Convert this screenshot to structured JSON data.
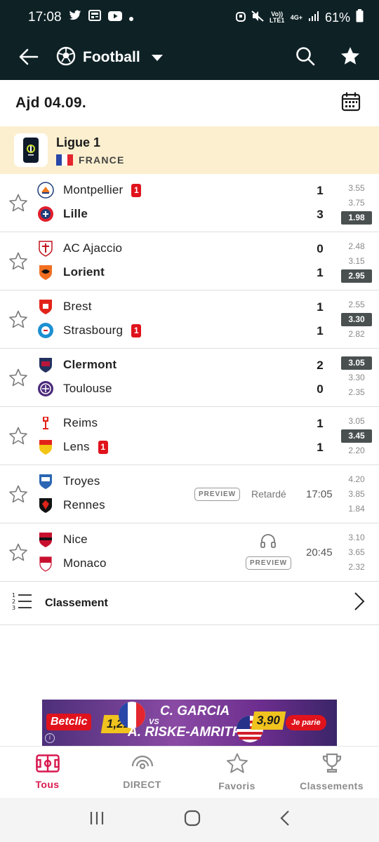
{
  "status_bar": {
    "time": "17:08",
    "network": "Vo)) LTE1",
    "net_type": "4G+",
    "battery": "61%"
  },
  "app_bar": {
    "sport_title": "Football"
  },
  "date_bar": {
    "date": "Ajd 04.09."
  },
  "league": {
    "name": "Ligue 1",
    "country": "FRANCE"
  },
  "matches": [
    {
      "home": "Montpellier",
      "away": "Lille",
      "home_bold": false,
      "away_bold": true,
      "home_red": "1",
      "away_red": "",
      "score_home": "1",
      "score_away": "3",
      "odds": [
        "3.55",
        "3.75",
        "1.98"
      ],
      "highlight": 2
    },
    {
      "home": "AC Ajaccio",
      "away": "Lorient",
      "home_bold": false,
      "away_bold": true,
      "home_red": "",
      "away_red": "",
      "score_home": "0",
      "score_away": "1",
      "odds": [
        "2.48",
        "3.15",
        "2.95"
      ],
      "highlight": 2
    },
    {
      "home": "Brest",
      "away": "Strasbourg",
      "home_bold": false,
      "away_bold": false,
      "home_red": "",
      "away_red": "1",
      "score_home": "1",
      "score_away": "1",
      "odds": [
        "2.55",
        "3.30",
        "2.82"
      ],
      "highlight": 1
    },
    {
      "home": "Clermont",
      "away": "Toulouse",
      "home_bold": true,
      "away_bold": false,
      "home_red": "",
      "away_red": "",
      "score_home": "2",
      "score_away": "0",
      "odds": [
        "3.05",
        "3.30",
        "2.35"
      ],
      "highlight": 0
    },
    {
      "home": "Reims",
      "away": "Lens",
      "home_bold": false,
      "away_bold": false,
      "home_red": "",
      "away_red": "1",
      "score_home": "1",
      "score_away": "1",
      "odds": [
        "3.05",
        "3.45",
        "2.20"
      ],
      "highlight": 1
    },
    {
      "home": "Troyes",
      "away": "Rennes",
      "home_bold": false,
      "away_bold": false,
      "home_red": "",
      "away_red": "",
      "preview": "PREVIEW",
      "status": "Retardé",
      "time": "17:05",
      "odds": [
        "4.20",
        "3.85",
        "1.84"
      ],
      "highlight": -1
    },
    {
      "home": "Nice",
      "away": "Monaco",
      "home_bold": false,
      "away_bold": false,
      "home_red": "",
      "away_red": "",
      "preview": "PREVIEW",
      "time": "20:45",
      "audio": true,
      "odds": [
        "3.10",
        "3.65",
        "2.32"
      ],
      "highlight": -1
    }
  ],
  "standings": {
    "label": "Classement"
  },
  "ad": {
    "brand": "Betclic",
    "odd_left": "1,21",
    "odd_right": "3,90",
    "player1": "C. GARCIA",
    "vs": "VS",
    "player2": "A. RISKE-AMRITRAJ",
    "cta": "Je parie",
    "info": "i"
  },
  "bottom_nav": {
    "items": [
      "Tous",
      "DIRECT",
      "Favoris",
      "Classements"
    ],
    "active": 0
  },
  "colors": {
    "primary_dark": "#0e2226",
    "accent": "#d8194f",
    "red_card": "#e0131c",
    "league_bg": "#fbefcf"
  },
  "icons": {
    "app_bar": [
      "back-arrow-icon",
      "football-icon",
      "search-icon",
      "favorites-star-icon"
    ],
    "date_bar": [
      "calendar-icon"
    ]
  }
}
